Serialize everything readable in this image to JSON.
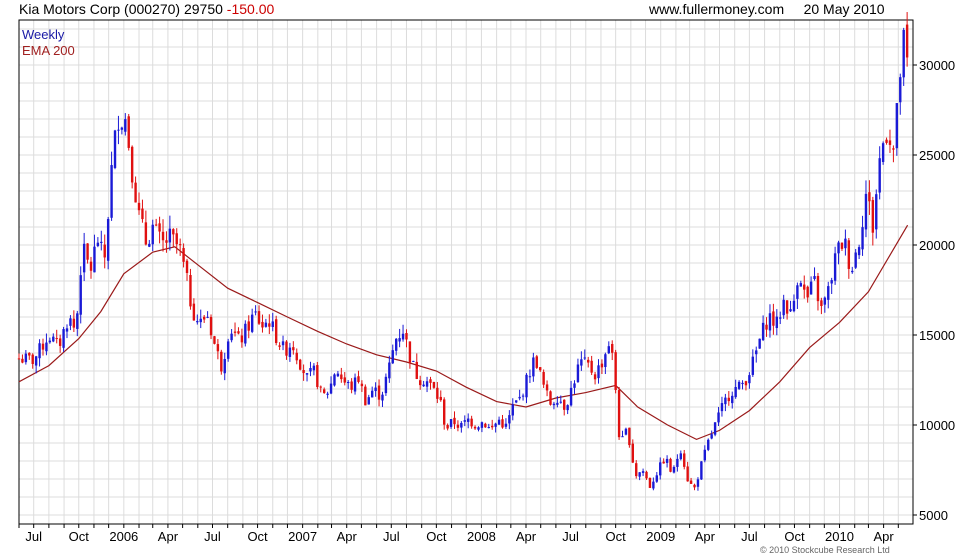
{
  "header": {
    "title": "Kia Motors Corp (000270) 29750",
    "change": "-150.00",
    "site": "www.fullermoney.com",
    "date": "20 May 2010"
  },
  "legend": {
    "frequency": "Weekly",
    "indicator": "EMA 200"
  },
  "copyright": "© 2010 Stockcube Research Ltd",
  "colors": {
    "up": "#1a1ad6",
    "down": "#e01010",
    "ema": "#9a1a1a",
    "grid": "#dcdcdc",
    "frame": "#000000"
  },
  "chart_data": {
    "type": "candlestick",
    "x_ticks": [
      "Jul",
      "Oct",
      "2006",
      "Apr",
      "Jul",
      "Oct",
      "2007",
      "Apr",
      "Jul",
      "Oct",
      "2008",
      "Apr",
      "Jul",
      "Oct",
      "2009",
      "Apr",
      "Jul",
      "Oct",
      "2010",
      "Apr"
    ],
    "y_ticks": [
      5000,
      10000,
      15000,
      20000,
      25000,
      30000
    ],
    "ylim": [
      4500,
      32500
    ],
    "grid": true,
    "close_path": [
      [
        "2005-06-01",
        13700
      ],
      [
        "2005-07-01",
        13600
      ],
      [
        "2005-08-01",
        15000
      ],
      [
        "2005-08-20",
        14300
      ],
      [
        "2005-09-10",
        16000
      ],
      [
        "2005-09-25",
        15200
      ],
      [
        "2005-10-08",
        19800
      ],
      [
        "2005-10-25",
        18600
      ],
      [
        "2005-11-08",
        20400
      ],
      [
        "2005-11-22",
        19000
      ],
      [
        "2005-12-08",
        24500
      ],
      [
        "2005-12-20",
        27200
      ],
      [
        "2006-01-05",
        27000
      ],
      [
        "2006-01-18",
        24200
      ],
      [
        "2006-02-01",
        21600
      ],
      [
        "2006-02-15",
        20200
      ],
      [
        "2006-03-01",
        21000
      ],
      [
        "2006-03-20",
        20000
      ],
      [
        "2006-04-05",
        20400
      ],
      [
        "2006-04-25",
        19800
      ],
      [
        "2006-05-08",
        18200
      ],
      [
        "2006-05-20",
        16500
      ],
      [
        "2006-06-05",
        15600
      ],
      [
        "2006-06-20",
        16200
      ],
      [
        "2006-07-05",
        14500
      ],
      [
        "2006-07-20",
        13200
      ],
      [
        "2006-08-05",
        15500
      ],
      [
        "2006-08-25",
        14600
      ],
      [
        "2006-09-10",
        15400
      ],
      [
        "2006-09-25",
        16200
      ],
      [
        "2006-10-10",
        15500
      ],
      [
        "2006-10-25",
        15800
      ],
      [
        "2006-11-10",
        14800
      ],
      [
        "2006-11-25",
        14100
      ],
      [
        "2006-12-10",
        14600
      ],
      [
        "2006-12-25",
        13600
      ],
      [
        "2007-01-10",
        12600
      ],
      [
        "2007-01-25",
        13000
      ],
      [
        "2007-02-10",
        11500
      ],
      [
        "2007-02-25",
        12000
      ],
      [
        "2007-03-10",
        13200
      ],
      [
        "2007-03-25",
        12400
      ],
      [
        "2007-04-10",
        12100
      ],
      [
        "2007-04-25",
        12600
      ],
      [
        "2007-05-10",
        11300
      ],
      [
        "2007-05-25",
        12000
      ],
      [
        "2007-06-10",
        11600
      ],
      [
        "2007-06-25",
        13000
      ],
      [
        "2007-07-10",
        14800
      ],
      [
        "2007-07-25",
        15300
      ],
      [
        "2007-08-10",
        13600
      ],
      [
        "2007-08-25",
        12600
      ],
      [
        "2007-09-10",
        12500
      ],
      [
        "2007-09-25",
        12000
      ],
      [
        "2007-10-10",
        11200
      ],
      [
        "2007-10-20",
        9800
      ],
      [
        "2007-11-05",
        10200
      ],
      [
        "2007-11-20",
        9900
      ],
      [
        "2007-12-05",
        10300
      ],
      [
        "2007-12-20",
        10000
      ],
      [
        "2008-01-05",
        10200
      ],
      [
        "2008-01-20",
        9700
      ],
      [
        "2008-02-05",
        10300
      ],
      [
        "2008-02-20",
        9900
      ],
      [
        "2008-03-05",
        11000
      ],
      [
        "2008-03-20",
        11500
      ],
      [
        "2008-04-05",
        12700
      ],
      [
        "2008-04-20",
        13800
      ],
      [
        "2008-05-05",
        12300
      ],
      [
        "2008-05-20",
        11200
      ],
      [
        "2008-06-05",
        11600
      ],
      [
        "2008-06-20",
        11000
      ],
      [
        "2008-07-05",
        12200
      ],
      [
        "2008-07-20",
        13500
      ],
      [
        "2008-08-05",
        13300
      ],
      [
        "2008-08-20",
        12800
      ],
      [
        "2008-09-05",
        13600
      ],
      [
        "2008-09-20",
        14800
      ],
      [
        "2008-10-01",
        12000
      ],
      [
        "2008-10-10",
        8800
      ],
      [
        "2008-10-25",
        9800
      ],
      [
        "2008-11-10",
        7200
      ],
      [
        "2008-11-25",
        7500
      ],
      [
        "2008-12-10",
        6600
      ],
      [
        "2008-12-25",
        7400
      ],
      [
        "2009-01-10",
        8200
      ],
      [
        "2009-01-25",
        7200
      ],
      [
        "2009-02-10",
        8800
      ],
      [
        "2009-02-25",
        7000
      ],
      [
        "2009-03-10",
        6400
      ],
      [
        "2009-03-25",
        7800
      ],
      [
        "2009-04-10",
        9200
      ],
      [
        "2009-04-25",
        10200
      ],
      [
        "2009-05-10",
        11200
      ],
      [
        "2009-05-25",
        11900
      ],
      [
        "2009-06-10",
        12100
      ],
      [
        "2009-06-25",
        12600
      ],
      [
        "2009-07-10",
        13600
      ],
      [
        "2009-07-25",
        15000
      ],
      [
        "2009-08-10",
        16100
      ],
      [
        "2009-08-25",
        15500
      ],
      [
        "2009-09-10",
        17000
      ],
      [
        "2009-09-25",
        16000
      ],
      [
        "2009-10-10",
        18800
      ],
      [
        "2009-10-25",
        16800
      ],
      [
        "2009-11-10",
        18000
      ],
      [
        "2009-11-25",
        16400
      ],
      [
        "2009-12-10",
        17500
      ],
      [
        "2009-12-25",
        19500
      ],
      [
        "2010-01-10",
        20300
      ],
      [
        "2010-01-25",
        18600
      ],
      [
        "2010-02-10",
        20300
      ],
      [
        "2010-02-25",
        23000
      ],
      [
        "2010-03-10",
        21000
      ],
      [
        "2010-03-25",
        25000
      ],
      [
        "2010-04-10",
        26700
      ],
      [
        "2010-04-20",
        25000
      ],
      [
        "2010-05-01",
        28000
      ],
      [
        "2010-05-10",
        31500
      ],
      [
        "2010-05-20",
        29750
      ]
    ],
    "ema_200": [
      [
        "2005-06-01",
        12400
      ],
      [
        "2005-08-01",
        13300
      ],
      [
        "2005-10-01",
        14800
      ],
      [
        "2005-11-15",
        16300
      ],
      [
        "2006-01-01",
        18400
      ],
      [
        "2006-03-01",
        19600
      ],
      [
        "2006-04-15",
        19900
      ],
      [
        "2006-06-01",
        18900
      ],
      [
        "2006-08-01",
        17600
      ],
      [
        "2006-10-01",
        16800
      ],
      [
        "2006-12-01",
        16000
      ],
      [
        "2007-02-01",
        15200
      ],
      [
        "2007-04-01",
        14500
      ],
      [
        "2007-06-01",
        13900
      ],
      [
        "2007-08-01",
        13500
      ],
      [
        "2007-10-01",
        13000
      ],
      [
        "2007-12-01",
        12100
      ],
      [
        "2008-02-01",
        11300
      ],
      [
        "2008-04-01",
        11000
      ],
      [
        "2008-06-01",
        11500
      ],
      [
        "2008-08-01",
        11800
      ],
      [
        "2008-10-01",
        12200
      ],
      [
        "2008-11-15",
        11000
      ],
      [
        "2009-01-15",
        10000
      ],
      [
        "2009-03-15",
        9200
      ],
      [
        "2009-05-01",
        9700
      ],
      [
        "2009-07-01",
        10800
      ],
      [
        "2009-09-01",
        12400
      ],
      [
        "2009-11-01",
        14300
      ],
      [
        "2010-01-01",
        15700
      ],
      [
        "2010-03-01",
        17400
      ],
      [
        "2010-05-20",
        21100
      ]
    ]
  }
}
